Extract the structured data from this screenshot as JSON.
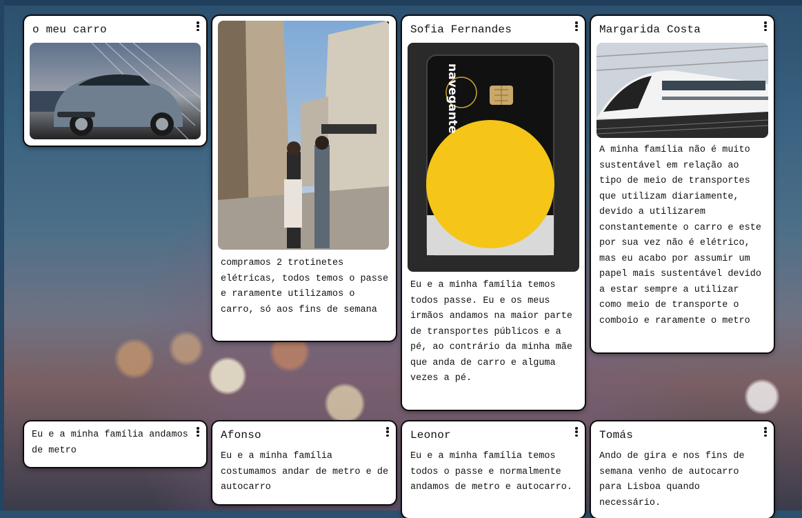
{
  "cards": [
    {
      "title": "o meu carro",
      "text": "",
      "image": "car-photo"
    },
    {
      "title": "",
      "text": "compramos 2 trotinetes elétricas, todos temos o passe e raramente utilizamos o carro, só aos fins de semana",
      "image": "street-photo"
    },
    {
      "title": "Sofia Fernandes",
      "text": "Eu e a minha família temos todos passe. Eu e os meus irmãos andamos na maior parte de transportes públicos e a pé, ao contrário da minha mãe que anda de carro e alguma vezes a pé.",
      "image": "navegante-card-photo",
      "image_label": "navegante"
    },
    {
      "title": "Margarida Costa",
      "text": "A minha família não é muito sustentável em relação ao tipo de meio de transportes que utilizam diariamente, devido a utilizarem constantemente o carro e este por sua vez não é elétrico, mas eu acabo por assumir um papel mais sustentável devido a estar sempre a utilizar como meio de transporte o comboio e raramente o metro",
      "image": "train-photo"
    },
    {
      "title": "",
      "text": "Eu e a minha família andamos de metro"
    },
    {
      "title": "Afonso",
      "text": "Eu e a minha família costumamos andar de metro e de autocarro"
    },
    {
      "title": "Leonor",
      "text": "Eu e a minha família temos todos o passe e normalmente andamos de metro e autocarro."
    },
    {
      "title": "Tomás",
      "text": "Ando de gira e nos fins de semana venho de autocarro para Lisboa quando necessário."
    }
  ],
  "icons": {
    "menu": "more-vertical-icon"
  },
  "colors": {
    "card_background": "#ffffff",
    "card_border": "#0b0b0b",
    "navegante_yellow": "#f5c518"
  }
}
